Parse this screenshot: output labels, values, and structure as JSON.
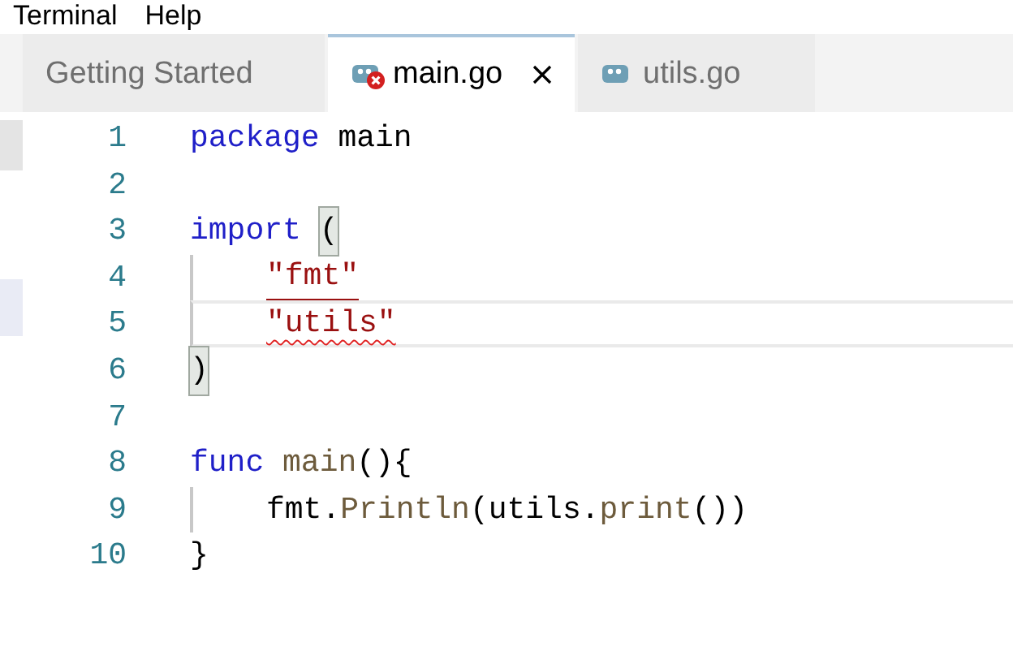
{
  "menu": [
    "Terminal",
    "Help"
  ],
  "tabs": [
    {
      "label": "Getting Started",
      "selected": false,
      "icon": false,
      "error": false,
      "closable": false
    },
    {
      "label": "main.go",
      "selected": true,
      "icon": true,
      "error": true,
      "closable": true
    },
    {
      "label": "utils.go",
      "selected": false,
      "icon": true,
      "error": false,
      "closable": false
    }
  ],
  "editor": {
    "lines": [
      {
        "number": "1",
        "indent": false,
        "current": false,
        "tokens": [
          {
            "kind": "keyword",
            "text": "package"
          },
          {
            "kind": "plain",
            "text": " main"
          }
        ]
      },
      {
        "number": "2",
        "indent": false,
        "current": false
      },
      {
        "number": "3",
        "indent": false,
        "current": false,
        "tokens": [
          {
            "kind": "keyword",
            "text": "import "
          },
          {
            "kind": "bracket_match",
            "text": "("
          }
        ]
      },
      {
        "number": "4",
        "indent": true,
        "current": false,
        "tokens": [
          {
            "kind": "string",
            "text": "\"fmt\"",
            "underlined": true,
            "error": false
          }
        ]
      },
      {
        "number": "5",
        "indent": true,
        "current": true,
        "tokens": [
          {
            "kind": "string",
            "text": "\"utils\"",
            "underlined": false,
            "error": true
          }
        ]
      },
      {
        "number": "6",
        "indent": false,
        "current": false,
        "tokens": [
          {
            "kind": "bracket_match",
            "text": ")"
          }
        ]
      },
      {
        "number": "7",
        "indent": false,
        "current": false
      },
      {
        "number": "8",
        "indent": false,
        "current": false,
        "tokens": [
          {
            "kind": "keyword",
            "text": "func "
          },
          {
            "kind": "function",
            "text": "main"
          },
          {
            "kind": "plain",
            "text": "(){"
          }
        ]
      },
      {
        "number": "9",
        "indent": true,
        "current": false,
        "tokens": [
          {
            "kind": "plain",
            "text": "fmt."
          },
          {
            "kind": "function",
            "text": "Println"
          },
          {
            "kind": "plain",
            "text": "(utils."
          },
          {
            "kind": "function",
            "text": "print"
          },
          {
            "kind": "plain",
            "text": "())"
          }
        ]
      },
      {
        "number": "10",
        "indent": false,
        "current": false,
        "tokens": [
          {
            "kind": "plain",
            "text": "}"
          }
        ]
      }
    ]
  }
}
